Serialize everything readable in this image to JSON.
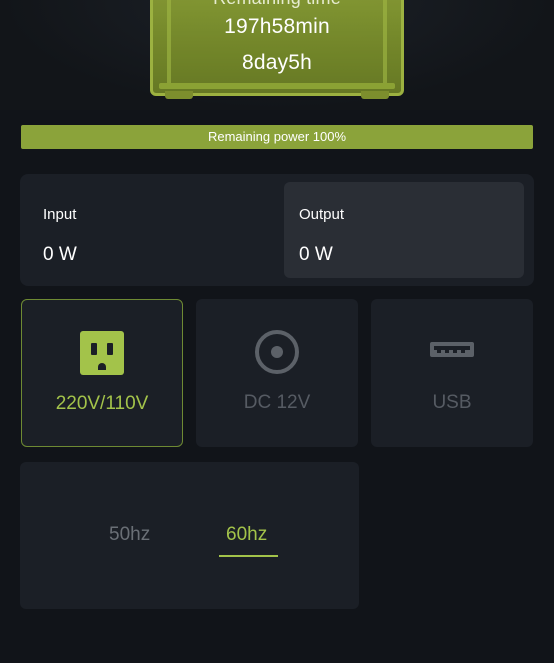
{
  "device": {
    "partial_label": "Remaining time",
    "time_hours": "197h58min",
    "time_days": "8day5h"
  },
  "battery": {
    "label": "Remaining power 100%",
    "level_percent": 100,
    "fill_color": "#8ba33a"
  },
  "io": {
    "input_title": "Input",
    "input_value": "0 W",
    "output_title": "Output",
    "output_value": "0 W"
  },
  "ports": [
    {
      "label": "220V/110V",
      "icon": "ac-outlet-icon",
      "active": true
    },
    {
      "label": "DC 12V",
      "icon": "dc-port-icon",
      "active": false
    },
    {
      "label": "USB",
      "icon": "usb-port-icon",
      "active": false
    }
  ],
  "frequency": {
    "options": [
      "50hz",
      "60hz"
    ],
    "selected": "60hz"
  },
  "colors": {
    "accent": "#a3c34a",
    "background": "#111419",
    "card": "#1b1f26"
  }
}
